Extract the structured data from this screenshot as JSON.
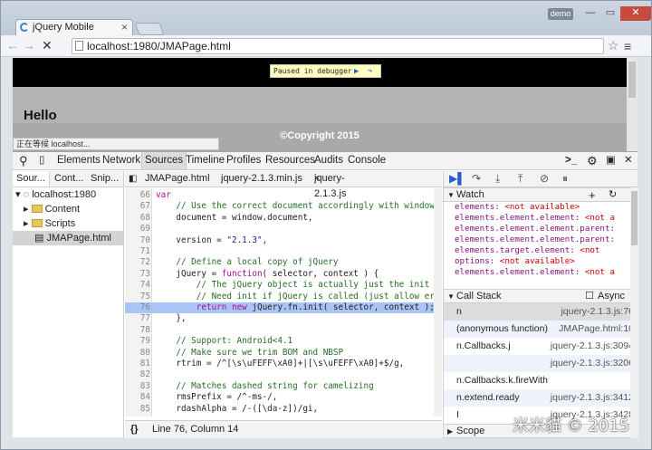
{
  "browser": {
    "tab_title": "jQuery Mobile",
    "profile": "demo",
    "url": "localhost:1980/JMAPage.html",
    "status_text": "正在等候 localhost..."
  },
  "page": {
    "paused_text": "Paused in debugger",
    "heading": "Hello",
    "footer": "©Copyright 2015"
  },
  "devtools": {
    "tabs": [
      "Elements",
      "Network",
      "Sources",
      "Timeline",
      "Profiles",
      "Resources",
      "Audits",
      "Console"
    ],
    "nav_tabs": [
      "Sour...",
      "Cont...",
      "Snip..."
    ],
    "tree": {
      "host": "localhost:1980",
      "folders": [
        "Content",
        "Scripts"
      ],
      "file": "JMAPage.html"
    },
    "file_tabs": [
      "JMAPage.html",
      "jquery-2.1.3.min.js",
      "jquery-2.1.3.js"
    ],
    "code_lines": [
      {
        "n": "66",
        "t": "var"
      },
      {
        "n": "67",
        "t": "    // Use the correct document accordingly with window"
      },
      {
        "n": "68",
        "t": "    document = window.document,"
      },
      {
        "n": "69",
        "t": ""
      },
      {
        "n": "70",
        "t": "    version = \"2.1.3\","
      },
      {
        "n": "71",
        "t": ""
      },
      {
        "n": "72",
        "t": "    // Define a local copy of jQuery"
      },
      {
        "n": "73",
        "t": "    jQuery = function( selector, context ) {"
      },
      {
        "n": "74",
        "t": "        // The jQuery object is actually just the init"
      },
      {
        "n": "75",
        "t": "        // Need init if jQuery is called (just allow er"
      },
      {
        "n": "76",
        "t": "        return new jQuery.fn.init( selector, context );"
      },
      {
        "n": "77",
        "t": "    },"
      },
      {
        "n": "78",
        "t": ""
      },
      {
        "n": "79",
        "t": "    // Support: Android<4.1"
      },
      {
        "n": "80",
        "t": "    // Make sure we trim BOM and NBSP"
      },
      {
        "n": "81",
        "t": "    rtrim = /^[\\s\\uFEFF\\xA0]+|[\\s\\uFEFF\\xA0]+$/g,"
      },
      {
        "n": "82",
        "t": ""
      },
      {
        "n": "83",
        "t": "    // Matches dashed string for camelizing"
      },
      {
        "n": "84",
        "t": "    rmsPrefix = /^-ms-/,"
      },
      {
        "n": "85",
        "t": "    rdashAlpha = /-([\\da-z])/gi,"
      }
    ],
    "cursor_status": "Line 76, Column 14",
    "braces_icon": "{}",
    "watch_title": "Watch",
    "watch": [
      {
        "k": "elements",
        "v": "<not available>"
      },
      {
        "k": "elements.element.element",
        "v": "<not a"
      },
      {
        "k": "elements.element.element.parent",
        "v": ""
      },
      {
        "k": "elements.element.element.parent",
        "v": ""
      },
      {
        "k": "elements.target.element",
        "v": "<not"
      },
      {
        "k": "options",
        "v": "<not available>"
      },
      {
        "k": "elements.element.element",
        "v": "<not a"
      }
    ],
    "callstack_title": "Call Stack",
    "async_label": "Async",
    "callstack": [
      {
        "fn": "n",
        "loc": "jquery-2.1.3.js:76"
      },
      {
        "fn": "(anonymous function)",
        "loc": "JMAPage.html:10"
      },
      {
        "fn": "n.Callbacks.j",
        "loc": "jquery-2.1.3.js:3094"
      },
      {
        "fn": "",
        "loc": "jquery-2.1.3.js:3206"
      },
      {
        "fn": "n.Callbacks.k.fireWith",
        "loc": ""
      },
      {
        "fn": "n.extend.ready",
        "loc": "jquery-2.1.3.js:3412"
      },
      {
        "fn": "I",
        "loc": "jquery-2.1.3.js:3428"
      }
    ],
    "scope_title": "Scope"
  },
  "watermark": "米米貓 © 2015"
}
